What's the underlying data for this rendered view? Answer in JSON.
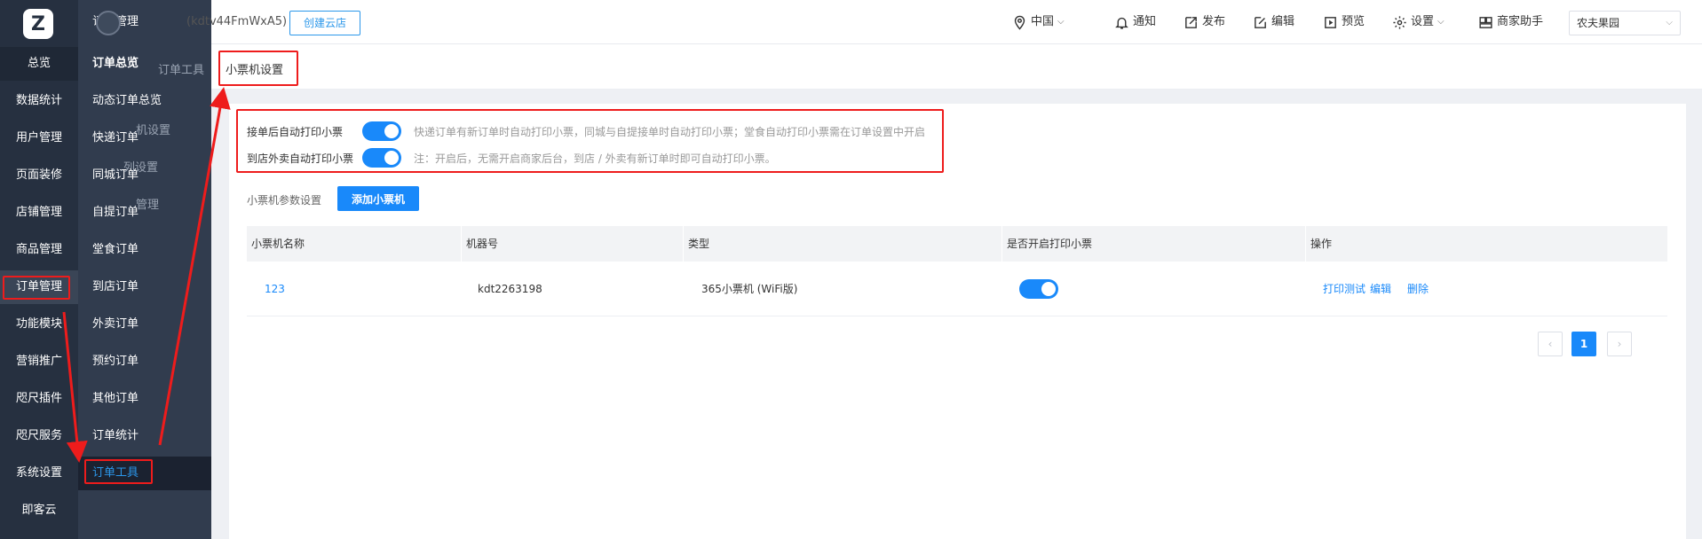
{
  "left_nav": {
    "logo": "Z",
    "items": [
      "总览",
      "数据统计",
      "用户管理",
      "页面装修",
      "店铺管理",
      "商品管理",
      "订单管理",
      "功能模块",
      "营销推广",
      "咫尺插件",
      "咫尺服务",
      "系统设置",
      "即客云"
    ]
  },
  "sub_nav": {
    "header_top": "订单管理",
    "items": [
      "订单总览",
      "动态订单总览",
      "快递订单",
      "同城订单",
      "自提订单",
      "堂食订单",
      "到店订单",
      "外卖订单",
      "预约订单",
      "其他订单",
      "订单统计",
      "订单工具"
    ],
    "ghost": [
      "订单工具",
      "…机设置",
      "…列设置",
      "…管理"
    ]
  },
  "header": {
    "shop_id": "(kdtv44FmWxA5)",
    "create_store": "创建云店",
    "region": "中国",
    "notify": "通知",
    "publish": "发布",
    "edit": "编辑",
    "preview": "预览",
    "settings": "设置",
    "assistant": "商家助手",
    "shop_select": "农夫果园"
  },
  "page": {
    "title": "小票机设置",
    "auto_print_label": "接单后自动打印小票",
    "auto_print_tip": "快递订单有新订单时自动打印小票，同城与自提接单时自动打印小票；堂食自动打印小票需在订单设置中开启",
    "auto_print_on": true,
    "instore_print_label": "到店外卖自动打印小票",
    "instore_print_tip": "注：开启后，无需开启商家后台，到店 / 外卖有新订单时即可自动打印小票。",
    "instore_print_on": true,
    "param_label": "小票机参数设置",
    "add_button": "添加小票机"
  },
  "table": {
    "columns": [
      "小票机名称",
      "机器号",
      "类型",
      "是否开启打印小票",
      "操作"
    ],
    "rows": [
      {
        "name": "123",
        "machine_no": "kdt2263198",
        "type": "365小票机 (WiFi版)",
        "enabled": true,
        "actions": [
          "打印测试",
          "编辑",
          "删除"
        ]
      }
    ]
  },
  "pagination": {
    "prev": "‹",
    "current": "1",
    "next": "›"
  },
  "colors": {
    "accent": "#1989fa",
    "annotation": "#ee1c1c",
    "sidebar": "#263040",
    "subnav": "#313c4e"
  }
}
